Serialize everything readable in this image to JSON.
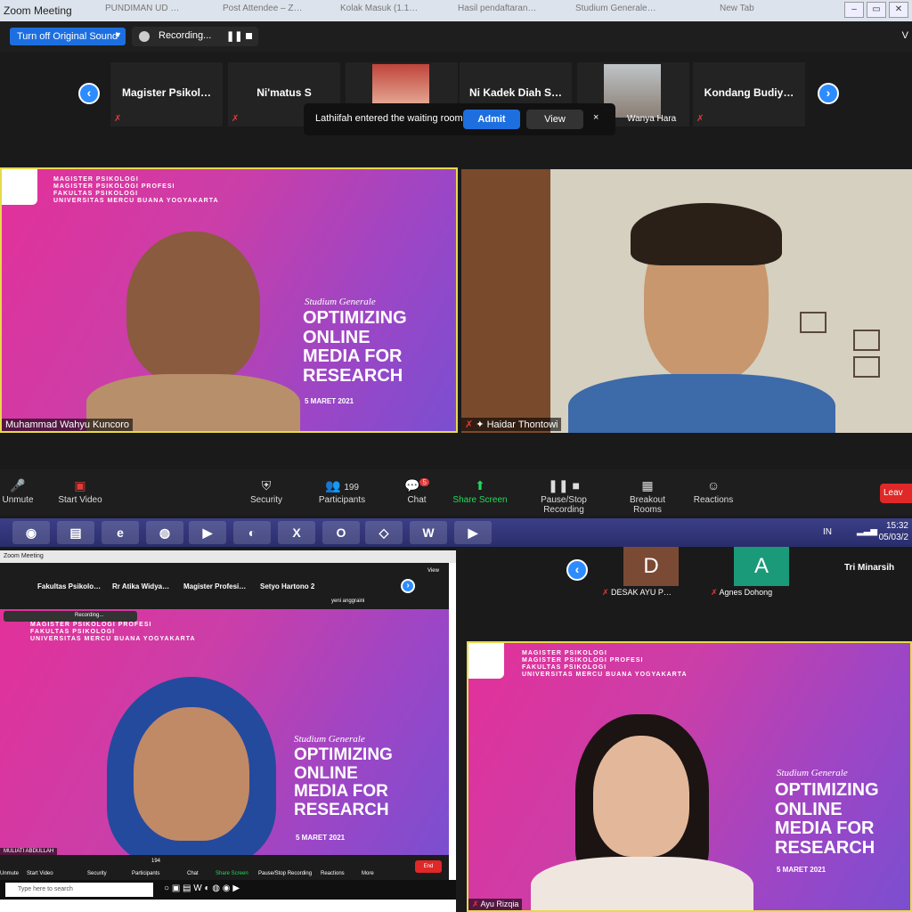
{
  "window": {
    "title": "Zoom Meeting",
    "tabs": [
      "PUNDIMAN UD …",
      "Post Attendee – Z…",
      "Kolak Masuk (1.1…",
      "Hasil pendaftaran…",
      "Studium Generale…",
      "New Tab"
    ]
  },
  "top_bar": {
    "original_sound_button": "Turn off Original Sound",
    "recording_label": "Recording...",
    "view_label": "V"
  },
  "participant_strip": [
    {
      "name": "Magister  Psikol…",
      "has_photo": false
    },
    {
      "name": "Ni'matus S",
      "has_photo": false
    },
    {
      "name": "",
      "has_photo": true
    },
    {
      "name": "Ni Kadek Diah S…",
      "has_photo": false
    },
    {
      "name": "Wanya Hara",
      "has_photo": true
    },
    {
      "name": "Kondang  Budiy…",
      "has_photo": false
    }
  ],
  "notification": {
    "message": "Lathiifah entered the waiting room",
    "admit": "Admit",
    "view": "View",
    "close": "×"
  },
  "slide": {
    "header_lines": [
      "MAGISTER PSIKOLOGI",
      "MAGISTER PSIKOLOGI PROFESI",
      "FAKULTAS PSIKOLOGI",
      "UNIVERSITAS MERCU BUANA YOGYAKARTA"
    ],
    "subtitle": "Studium Generale",
    "title_lines": [
      "OPTIMIZING",
      "ONLINE",
      "MEDIA FOR",
      "RESEARCH"
    ],
    "date": "5 MARET 2021"
  },
  "videos": {
    "speaker1": "Muhammad Wahyu Kuncoro",
    "speaker2": "Haidar Thontowi"
  },
  "controls": [
    {
      "label": "Unmute",
      "icon": "mic-muted-icon"
    },
    {
      "label": "Start Video",
      "icon": "video-off-icon"
    },
    {
      "label": "Security",
      "icon": "shield-icon"
    },
    {
      "label": "Participants",
      "icon": "participants-icon",
      "count": "199"
    },
    {
      "label": "Chat",
      "icon": "chat-icon",
      "badge": "5"
    },
    {
      "label": "Share Screen",
      "icon": "share-screen-icon"
    },
    {
      "label": "Pause/Stop Recording",
      "icon": "recording-icon"
    },
    {
      "label": "Breakout Rooms",
      "icon": "breakout-rooms-icon"
    },
    {
      "label": "Reactions",
      "icon": "reactions-icon"
    }
  ],
  "leave_label": "Leav",
  "taskbar": {
    "lang": "IN",
    "time": "15:32",
    "date": "05/03/2"
  },
  "bottom_left": {
    "title": "Zoom Meeting",
    "strip_names": [
      "Fakultas  Psikolo…",
      "Rr Atika Widya…",
      "Magister  Profesi…",
      "Setyo Hartono 2"
    ],
    "extra_name": "yeni anggraini",
    "view_label": "View",
    "recording_label": "Recording...",
    "speaker": "MULIATI ABDULLAH",
    "controls": [
      "Unmute",
      "Start Video",
      "Security",
      "Participants",
      "Chat",
      "Share Screen",
      "Pause/Stop Recording",
      "Reactions",
      "More"
    ],
    "participants_count": "194",
    "end_label": "End",
    "search_placeholder": "Type here to search"
  },
  "bottom_right": {
    "strip": [
      {
        "initial": "D",
        "name": "DESAK AYU P…"
      },
      {
        "initial": "A",
        "name": "Agnes Dohong"
      },
      {
        "initial": "",
        "name": "Tri Minarsih"
      }
    ],
    "speaker": "Ayu Rizqia"
  },
  "colors": {
    "zoom_blue": "#2d8cff",
    "leave_red": "#e02828",
    "share_green": "#23d959",
    "slide_pink": "#e3309a",
    "slide_purple": "#7a4fd0"
  }
}
